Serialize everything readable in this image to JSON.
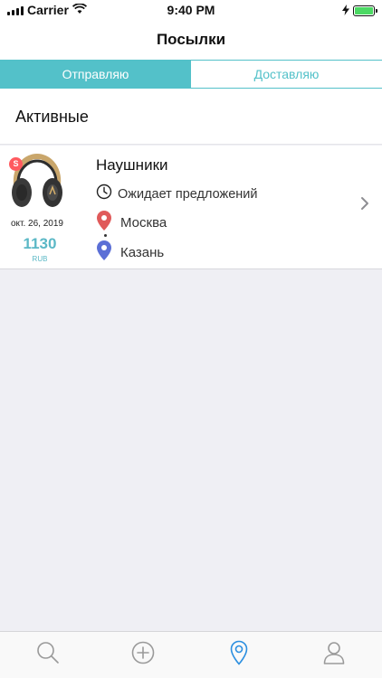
{
  "status_bar": {
    "carrier": "Carrier",
    "time": "9:40 PM"
  },
  "nav": {
    "title": "Посылки"
  },
  "segments": [
    {
      "label": "Отправляю",
      "active": true
    },
    {
      "label": "Доставляю",
      "active": false
    }
  ],
  "section": {
    "title": "Активные"
  },
  "parcel": {
    "badge": "S",
    "date": "окт. 26, 2019",
    "price": "1130",
    "currency": "RUB",
    "title": "Наушники",
    "status": "Ожидает предложений",
    "from": "Москва",
    "to": "Казань",
    "image_icon": "headphones-photo"
  },
  "tabs": [
    {
      "icon": "search-icon",
      "active": false
    },
    {
      "icon": "add-icon",
      "active": false
    },
    {
      "icon": "location-pin-icon",
      "active": true
    },
    {
      "icon": "profile-icon",
      "active": false
    }
  ],
  "colors": {
    "accent": "#53c1c9",
    "price": "#5bb8c6",
    "from_pin": "#e05a5a",
    "to_pin": "#5b6fd6",
    "active_tab": "#2c8fe0",
    "inactive_tab": "#9a9a9a",
    "battery": "#4cd964"
  }
}
